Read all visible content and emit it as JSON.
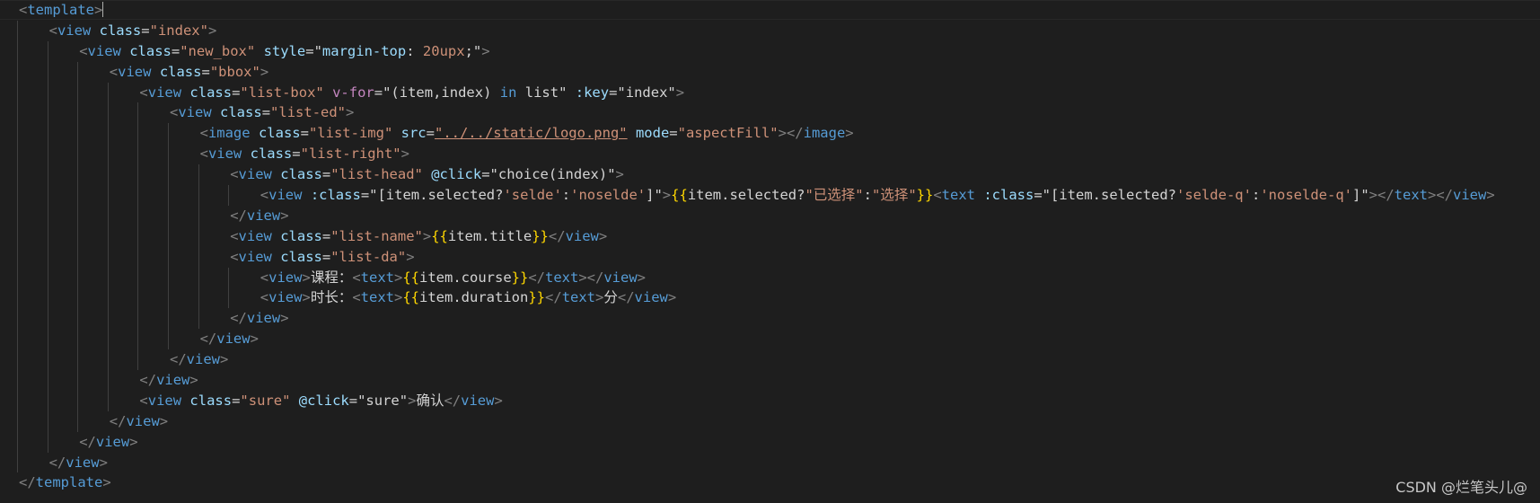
{
  "editor": {
    "language": "vue-template",
    "theme_colors": {
      "background": "#1e1e1e",
      "tag_bracket": "#808080",
      "tag_name": "#569cd6",
      "attribute": "#9cdcfe",
      "string": "#ce9178",
      "mustache": "#ffd700",
      "keyword": "#c586c0",
      "text": "#d4d4d4"
    },
    "lines": [
      {
        "indent": 0,
        "tokens": [
          [
            "t",
            "<"
          ],
          [
            "n",
            "template"
          ],
          [
            "t",
            ">"
          ],
          [
            "caret",
            ""
          ]
        ]
      },
      {
        "indent": 1,
        "tokens": [
          [
            "t",
            "<"
          ],
          [
            "n",
            "view"
          ],
          [
            "x",
            " "
          ],
          [
            "a",
            "class"
          ],
          [
            "x",
            "="
          ],
          [
            "s",
            "\"index\""
          ],
          [
            "t",
            ">"
          ]
        ]
      },
      {
        "indent": 2,
        "tokens": [
          [
            "t",
            "<"
          ],
          [
            "n",
            "view"
          ],
          [
            "x",
            " "
          ],
          [
            "a",
            "class"
          ],
          [
            "x",
            "="
          ],
          [
            "s",
            "\"new_box\""
          ],
          [
            "x",
            " "
          ],
          [
            "a",
            "style"
          ],
          [
            "x",
            "=\""
          ],
          [
            "a",
            "margin-top"
          ],
          [
            "x",
            ": "
          ],
          [
            "s",
            "20upx"
          ],
          [
            "x",
            ";\""
          ],
          [
            "t",
            ">"
          ]
        ]
      },
      {
        "indent": 3,
        "tokens": [
          [
            "t",
            "<"
          ],
          [
            "n",
            "view"
          ],
          [
            "x",
            " "
          ],
          [
            "a",
            "class"
          ],
          [
            "x",
            "="
          ],
          [
            "s",
            "\"bbox\""
          ],
          [
            "t",
            ">"
          ]
        ]
      },
      {
        "indent": 4,
        "tokens": [
          [
            "t",
            "<"
          ],
          [
            "n",
            "view"
          ],
          [
            "x",
            " "
          ],
          [
            "a",
            "class"
          ],
          [
            "x",
            "="
          ],
          [
            "s",
            "\"list-box\""
          ],
          [
            "x",
            " "
          ],
          [
            "kw",
            "v-for"
          ],
          [
            "x",
            "=\"(item,index) "
          ],
          [
            "bk",
            "in"
          ],
          [
            "x",
            " list\" "
          ],
          [
            "a",
            ":key"
          ],
          [
            "x",
            "=\"index\""
          ],
          [
            "t",
            ">"
          ]
        ]
      },
      {
        "indent": 5,
        "tokens": [
          [
            "t",
            "<"
          ],
          [
            "n",
            "view"
          ],
          [
            "x",
            " "
          ],
          [
            "a",
            "class"
          ],
          [
            "x",
            "="
          ],
          [
            "s",
            "\"list-ed\""
          ],
          [
            "t",
            ">"
          ]
        ]
      },
      {
        "indent": 6,
        "tokens": [
          [
            "t",
            "<"
          ],
          [
            "n",
            "image"
          ],
          [
            "x",
            " "
          ],
          [
            "a",
            "class"
          ],
          [
            "x",
            "="
          ],
          [
            "s",
            "\"list-img\""
          ],
          [
            "x",
            " "
          ],
          [
            "a",
            "src"
          ],
          [
            "x",
            "="
          ],
          [
            "su",
            "\"../../static/logo.png\""
          ],
          [
            "x",
            " "
          ],
          [
            "a",
            "mode"
          ],
          [
            "x",
            "="
          ],
          [
            "s",
            "\"aspectFill\""
          ],
          [
            "t",
            "></"
          ],
          [
            "n",
            "image"
          ],
          [
            "t",
            ">"
          ]
        ]
      },
      {
        "indent": 6,
        "tokens": [
          [
            "t",
            "<"
          ],
          [
            "n",
            "view"
          ],
          [
            "x",
            " "
          ],
          [
            "a",
            "class"
          ],
          [
            "x",
            "="
          ],
          [
            "s",
            "\"list-right\""
          ],
          [
            "t",
            ">"
          ]
        ]
      },
      {
        "indent": 7,
        "tokens": [
          [
            "t",
            "<"
          ],
          [
            "n",
            "view"
          ],
          [
            "x",
            " "
          ],
          [
            "a",
            "class"
          ],
          [
            "x",
            "="
          ],
          [
            "s",
            "\"list-head\""
          ],
          [
            "x",
            " "
          ],
          [
            "a",
            "@click"
          ],
          [
            "x",
            "=\"choice(index)\""
          ],
          [
            "t",
            ">"
          ]
        ]
      },
      {
        "indent": 8,
        "tokens": [
          [
            "t",
            "<"
          ],
          [
            "n",
            "view"
          ],
          [
            "x",
            " "
          ],
          [
            "a",
            ":class"
          ],
          [
            "x",
            "=\"[item.selected?"
          ],
          [
            "s",
            "'selde'"
          ],
          [
            "x",
            ":"
          ],
          [
            "s",
            "'noselde'"
          ],
          [
            "x",
            "]\""
          ],
          [
            "t",
            ">"
          ],
          [
            "m",
            "{{"
          ],
          [
            "x",
            "item.selected?"
          ],
          [
            "s",
            "\"已选择\""
          ],
          [
            "x",
            ":"
          ],
          [
            "s",
            "\"选择\""
          ],
          [
            "m",
            "}}"
          ],
          [
            "t",
            "<"
          ],
          [
            "n",
            "text"
          ],
          [
            "x",
            " "
          ],
          [
            "a",
            ":class"
          ],
          [
            "x",
            "=\"[item.selected?"
          ],
          [
            "s",
            "'selde-q'"
          ],
          [
            "x",
            ":"
          ],
          [
            "s",
            "'noselde-q'"
          ],
          [
            "x",
            "]\""
          ],
          [
            "t",
            "></"
          ],
          [
            "n",
            "text"
          ],
          [
            "t",
            "></"
          ],
          [
            "n",
            "view"
          ],
          [
            "t",
            ">"
          ]
        ]
      },
      {
        "indent": 7,
        "tokens": [
          [
            "t",
            "</"
          ],
          [
            "n",
            "view"
          ],
          [
            "t",
            ">"
          ]
        ]
      },
      {
        "indent": 7,
        "tokens": [
          [
            "t",
            "<"
          ],
          [
            "n",
            "view"
          ],
          [
            "x",
            " "
          ],
          [
            "a",
            "class"
          ],
          [
            "x",
            "="
          ],
          [
            "s",
            "\"list-name\""
          ],
          [
            "t",
            ">"
          ],
          [
            "m",
            "{{"
          ],
          [
            "x",
            "item.title"
          ],
          [
            "m",
            "}}"
          ],
          [
            "t",
            "</"
          ],
          [
            "n",
            "view"
          ],
          [
            "t",
            ">"
          ]
        ]
      },
      {
        "indent": 7,
        "tokens": [
          [
            "t",
            "<"
          ],
          [
            "n",
            "view"
          ],
          [
            "x",
            " "
          ],
          [
            "a",
            "class"
          ],
          [
            "x",
            "="
          ],
          [
            "s",
            "\"list-da\""
          ],
          [
            "t",
            ">"
          ]
        ]
      },
      {
        "indent": 8,
        "tokens": [
          [
            "t",
            "<"
          ],
          [
            "n",
            "view"
          ],
          [
            "t",
            ">"
          ],
          [
            "x",
            "课程："
          ],
          [
            "t",
            "<"
          ],
          [
            "n",
            "text"
          ],
          [
            "t",
            ">"
          ],
          [
            "m",
            "{{"
          ],
          [
            "x",
            "item.course"
          ],
          [
            "m",
            "}}"
          ],
          [
            "t",
            "</"
          ],
          [
            "n",
            "text"
          ],
          [
            "t",
            "></"
          ],
          [
            "n",
            "view"
          ],
          [
            "t",
            ">"
          ]
        ]
      },
      {
        "indent": 8,
        "tokens": [
          [
            "t",
            "<"
          ],
          [
            "n",
            "view"
          ],
          [
            "t",
            ">"
          ],
          [
            "x",
            "时长："
          ],
          [
            "t",
            "<"
          ],
          [
            "n",
            "text"
          ],
          [
            "t",
            ">"
          ],
          [
            "m",
            "{{"
          ],
          [
            "x",
            "item.duration"
          ],
          [
            "m",
            "}}"
          ],
          [
            "t",
            "</"
          ],
          [
            "n",
            "text"
          ],
          [
            "t",
            ">"
          ],
          [
            "x",
            "分"
          ],
          [
            "t",
            "</"
          ],
          [
            "n",
            "view"
          ],
          [
            "t",
            ">"
          ]
        ]
      },
      {
        "indent": 7,
        "tokens": [
          [
            "t",
            "</"
          ],
          [
            "n",
            "view"
          ],
          [
            "t",
            ">"
          ]
        ]
      },
      {
        "indent": 6,
        "tokens": [
          [
            "t",
            "</"
          ],
          [
            "n",
            "view"
          ],
          [
            "t",
            ">"
          ]
        ]
      },
      {
        "indent": 5,
        "tokens": [
          [
            "t",
            "</"
          ],
          [
            "n",
            "view"
          ],
          [
            "t",
            ">"
          ]
        ]
      },
      {
        "indent": 4,
        "tokens": [
          [
            "t",
            "</"
          ],
          [
            "n",
            "view"
          ],
          [
            "t",
            ">"
          ]
        ]
      },
      {
        "indent": 4,
        "tokens": [
          [
            "t",
            "<"
          ],
          [
            "n",
            "view"
          ],
          [
            "x",
            " "
          ],
          [
            "a",
            "class"
          ],
          [
            "x",
            "="
          ],
          [
            "s",
            "\"sure\""
          ],
          [
            "x",
            " "
          ],
          [
            "a",
            "@click"
          ],
          [
            "x",
            "=\"sure\""
          ],
          [
            "t",
            ">"
          ],
          [
            "x",
            "确认"
          ],
          [
            "t",
            "</"
          ],
          [
            "n",
            "view"
          ],
          [
            "t",
            ">"
          ]
        ]
      },
      {
        "indent": 3,
        "tokens": [
          [
            "t",
            "</"
          ],
          [
            "n",
            "view"
          ],
          [
            "t",
            ">"
          ]
        ]
      },
      {
        "indent": 2,
        "tokens": [
          [
            "t",
            "</"
          ],
          [
            "n",
            "view"
          ],
          [
            "t",
            ">"
          ]
        ]
      },
      {
        "indent": 1,
        "tokens": [
          [
            "t",
            "</"
          ],
          [
            "n",
            "view"
          ],
          [
            "t",
            ">"
          ]
        ]
      },
      {
        "indent": 0,
        "tokens": [
          [
            "t",
            "</"
          ],
          [
            "n",
            "template"
          ],
          [
            "t",
            ">"
          ]
        ]
      }
    ]
  },
  "watermark": {
    "text": "CSDN @烂笔头儿@"
  }
}
